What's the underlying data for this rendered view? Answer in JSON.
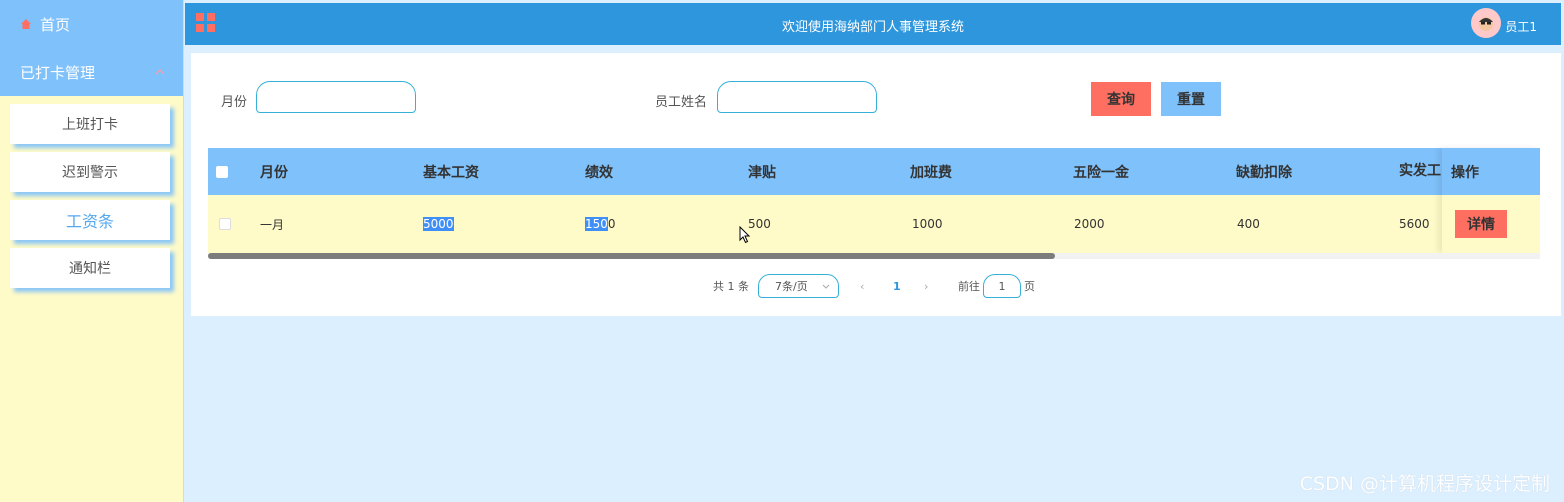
{
  "sidebar": {
    "home_label": "首页",
    "group_label": "已打卡管理",
    "items": [
      {
        "label": "上班打卡"
      },
      {
        "label": "迟到警示"
      },
      {
        "label": "工资条"
      },
      {
        "label": "通知栏"
      }
    ]
  },
  "header": {
    "title": "欢迎使用海纳部门人事管理系统",
    "user": "员工1"
  },
  "filters": {
    "month_label": "月份",
    "month_value": "",
    "name_label": "员工姓名",
    "name_value": "",
    "query_label": "查询",
    "reset_label": "重置"
  },
  "table": {
    "headers": [
      "月份",
      "基本工资",
      "绩效",
      "津贴",
      "加班费",
      "五险一金",
      "缺勤扣除",
      "实发工资"
    ],
    "op_header": "操作",
    "rows": [
      {
        "month": "一月",
        "base": "5000",
        "perf_a": "150",
        "perf_b": "0",
        "allowance": "500",
        "overtime": "1000",
        "insurance": "2000",
        "absence": "400",
        "net": "5600",
        "action": "详情"
      }
    ]
  },
  "pagination": {
    "total_text": "共 1 条",
    "page_size": "7条/页",
    "current_page": "1",
    "goto_prefix": "前往",
    "goto_value": "1",
    "goto_suffix": "页"
  },
  "watermark": "CSDN @计算机程序设计定制",
  "colors": {
    "header_bg": "#2e96dc",
    "sidebar_bg": "#fffbc8",
    "nav_bg": "#7fc1fb",
    "accent_red": "#ff6f61",
    "page_bg": "#dcefff"
  }
}
